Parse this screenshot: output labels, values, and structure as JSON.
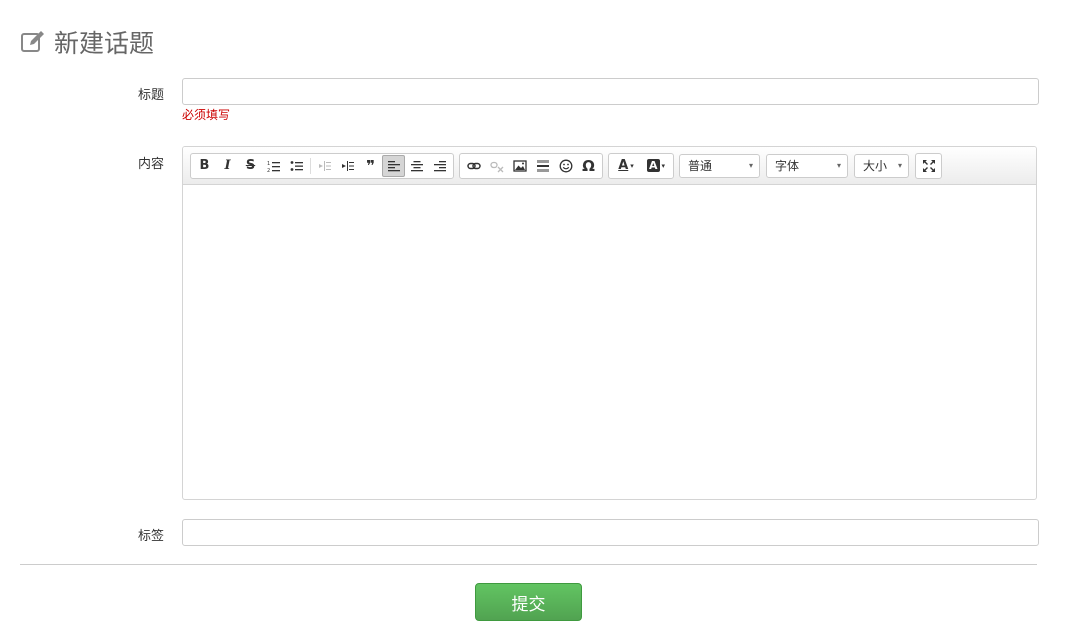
{
  "header": {
    "title": "新建话题",
    "icon": "edit-icon"
  },
  "form": {
    "title_label": "标题",
    "title_value": "",
    "title_placeholder": "",
    "title_hint": "必须填写",
    "content_label": "内容",
    "tags_label": "标签",
    "tags_value": "",
    "tags_placeholder": ""
  },
  "toolbar": {
    "bold": "B",
    "italic": "I",
    "strike": "S",
    "quote": "❞",
    "omega": "Ω",
    "font_color": "A",
    "bg_color": "A",
    "format_select": "普通",
    "font_select": "字体",
    "size_select": "大小"
  },
  "submit_label": "提交",
  "colors": {
    "accent_green": "#5cb85c",
    "hint_red": "#cc0000"
  }
}
